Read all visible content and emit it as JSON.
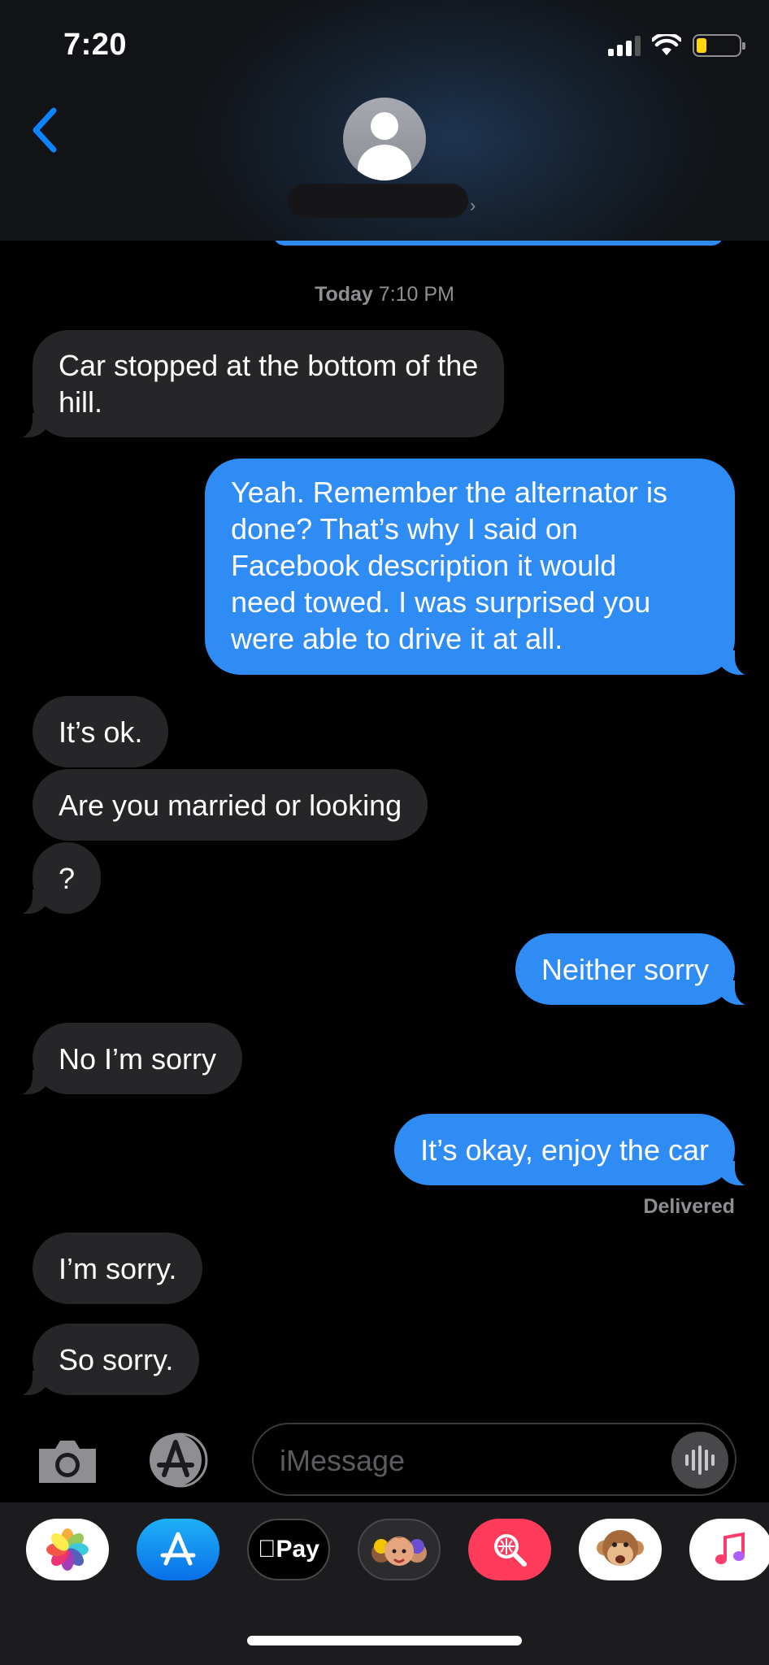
{
  "status_bar": {
    "time": "7:20"
  },
  "header": {
    "contact_name": ""
  },
  "thread": {
    "timestamp_day": "Today",
    "timestamp_time": "7:10 PM",
    "messages": [
      {
        "direction": "incoming",
        "lines": [
          "Car stopped at the bottom of the",
          "hill."
        ]
      },
      {
        "direction": "outgoing",
        "lines": [
          "Yeah. Remember the alternator is",
          "done? That’s why I said on",
          "Facebook description it would",
          "need towed. I was surprised you",
          "were able to drive it at all."
        ]
      },
      {
        "direction": "incoming",
        "lines": [
          "It’s ok."
        ]
      },
      {
        "direction": "incoming",
        "lines": [
          "Are you married or looking"
        ]
      },
      {
        "direction": "incoming",
        "lines": [
          "?"
        ]
      },
      {
        "direction": "outgoing",
        "lines": [
          "Neither sorry"
        ]
      },
      {
        "direction": "incoming",
        "lines": [
          "No I’m sorry"
        ]
      },
      {
        "direction": "outgoing",
        "lines": [
          "It’s okay, enjoy the car"
        ]
      },
      {
        "direction": "incoming",
        "lines": [
          "I’m sorry."
        ]
      },
      {
        "direction": "incoming",
        "lines": [
          "So sorry."
        ]
      }
    ],
    "delivered_label": "Delivered"
  },
  "composer": {
    "placeholder": "iMessage"
  },
  "app_drawer": {
    "apps": [
      "photos-icon",
      "app-store-icon",
      "apple-pay-icon",
      "memoji-icon",
      "web-images-icon",
      "animoji-icon",
      "music-icon"
    ],
    "apple_pay_label": "Pay"
  },
  "colors": {
    "outgoing_bubble": "#2f8cf5",
    "incoming_bubble": "#262628",
    "accent": "#0a84ff"
  }
}
